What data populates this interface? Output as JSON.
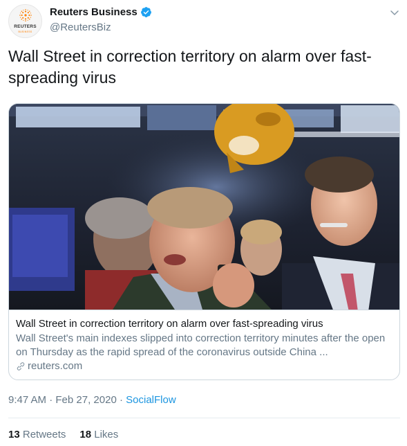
{
  "author": {
    "display_name": "Reuters Business",
    "handle": "@ReutersBiz",
    "avatar_wordmark": "REUTERS",
    "avatar_subtext": "BUSINESS",
    "verified": true
  },
  "tweet": {
    "text": "Wall Street in correction territory on alarm over fast-spreading virus"
  },
  "card": {
    "title": "Wall Street in correction territory on alarm over fast-spreading virus",
    "description": "Wall Street's main indexes slipped into correction territory minutes after the open on Thursday as the rapid spread of the coronavirus outside China ...",
    "domain": "reuters.com",
    "image_icon": "photo-trading-floor"
  },
  "meta": {
    "time": "9:47 AM",
    "separator": " · ",
    "date": "Feb 27, 2020",
    "source": "SocialFlow"
  },
  "stats": {
    "retweets_count": "13",
    "retweets_label": "Retweets",
    "likes_count": "18",
    "likes_label": "Likes"
  },
  "colors": {
    "verified": "#1da1f2",
    "link": "#1b95e0",
    "secondary_text": "#657786",
    "border": "#ccd6dd"
  }
}
